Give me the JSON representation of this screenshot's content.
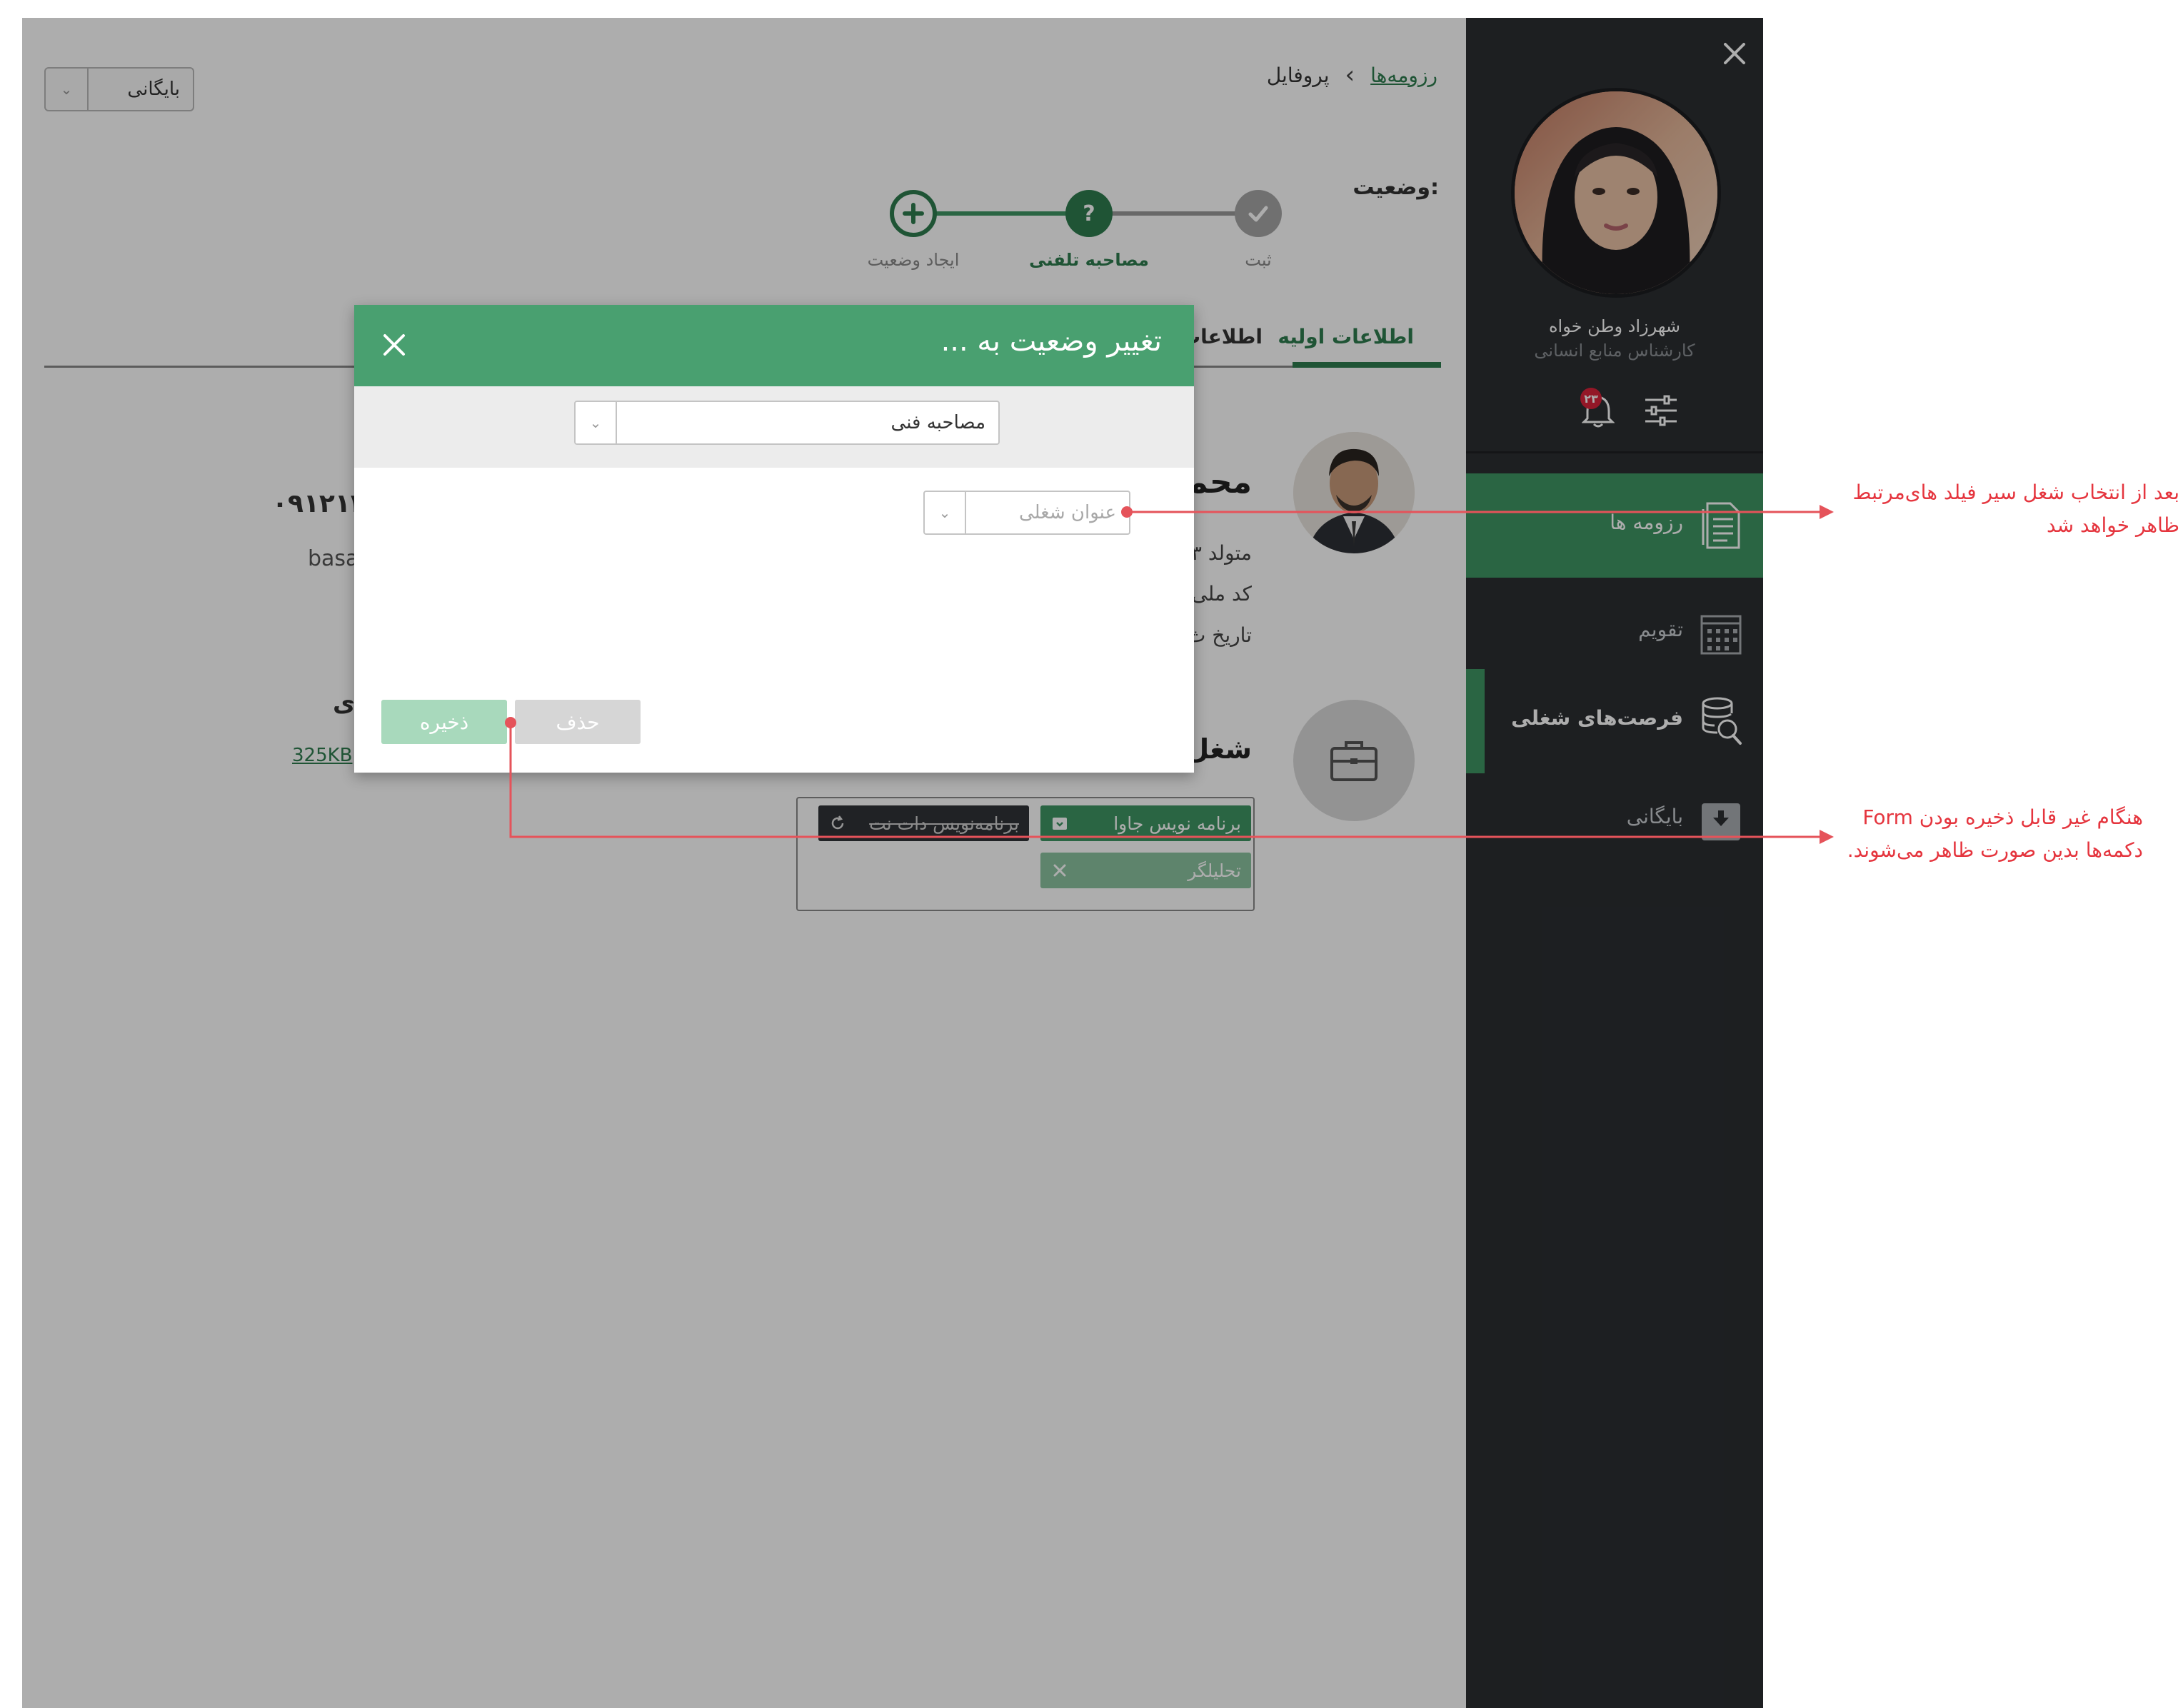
{
  "breadcrumb": {
    "link": "رزومه‌ها",
    "current": "پروفایل"
  },
  "archive_dropdown": {
    "value": "بایگانی"
  },
  "status": {
    "label": "وضعیت:",
    "steps": [
      "ثبت",
      "مصاحبه تلفنی",
      "ایجاد وضعیت"
    ],
    "current_step_symbol": "?"
  },
  "tabs": [
    "اطلاعات اولیه",
    "اطلاعات ت"
  ],
  "candidate": {
    "name_fragment": "محم",
    "phone_fragment": "۰۹۱۲۱۳۵",
    "email_fragment": "basa",
    "info_lines": [
      "متولد ۳",
      "کد ملی",
      "تاریخ ث"
    ],
    "side_fragment": "ی",
    "file_size": "325KB"
  },
  "jobs": {
    "heading": "شغل‌ه",
    "tags": [
      "برنامه نویس جاوا",
      "برنامه‌نویس دات نت",
      "تحلیلگر"
    ]
  },
  "sidebar": {
    "user_name": "شهرزاد  وطن خواه",
    "user_role": "کارشناس منابع انسانی",
    "notification_count": "۲۳",
    "menu": [
      {
        "label": "رزومه ها",
        "icon": "document-icon"
      },
      {
        "label": "تقویم",
        "icon": "calendar-icon"
      },
      {
        "label": "فرصت‌های شغلی",
        "icon": "database-search-icon"
      },
      {
        "label": "بایگانی",
        "icon": "archive-icon"
      }
    ]
  },
  "modal": {
    "title": "تغییر وضعیت به ...",
    "status_select_value": "مصاحبه فنی",
    "job_title_placeholder": "عنوان شغلی",
    "delete_label": "حذف",
    "save_label": "ذخیره"
  },
  "annotations": {
    "note1_line1": "بعد از انتخاب شغل  سیر فیلد های‌مرتبط",
    "note1_line2": "ظاهر خواهد شد",
    "note2_line1": "هنگام غیر قابل ذخیره بودن  Form",
    "note2_line2": "دکمه‌ها بدین صورت ظاهر می‌شوند."
  },
  "colors": {
    "brand_green": "#49a070",
    "dark_green": "#2e7d4f",
    "sidebar_bg": "#2b2e32",
    "annotation_red": "#e5353e",
    "badge_red": "#d9223a"
  }
}
